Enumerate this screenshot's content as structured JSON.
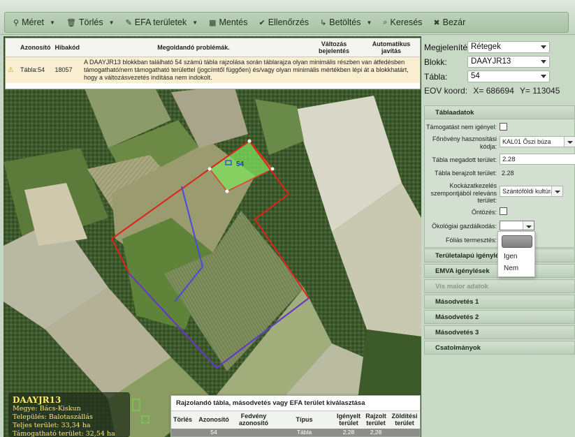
{
  "toolbar": {
    "items": [
      {
        "label": "Méret",
        "icon": "pin-icon",
        "glyph": "⚲",
        "dropdown": true
      },
      {
        "label": "Törlés",
        "icon": "trash-icon",
        "glyph": "🗑",
        "dropdown": true
      },
      {
        "label": "EFA területek",
        "icon": "pencil-icon",
        "glyph": "✎",
        "dropdown": true
      },
      {
        "label": "Mentés",
        "icon": "save-icon",
        "glyph": "▦",
        "dropdown": false
      },
      {
        "label": "Ellenőrzés",
        "icon": "check-icon",
        "glyph": "✔",
        "dropdown": false
      },
      {
        "label": "Betöltés",
        "icon": "load-icon",
        "glyph": "↳",
        "dropdown": true
      },
      {
        "label": "Keresés",
        "icon": "search-icon",
        "glyph": "⌕",
        "dropdown": false
      },
      {
        "label": "Bezár",
        "icon": "close-icon",
        "glyph": "✖",
        "dropdown": false
      }
    ]
  },
  "problems": {
    "headers": {
      "azonosito": "Azonosító",
      "hibakod": "Hibakód",
      "problem": "Megoldandó problémák.",
      "valtozas": "Változás bejelentés",
      "javitas": "Automatikus javítás"
    },
    "rows": [
      {
        "azonosito": "Tábla:54",
        "hibakod": "18057",
        "text": "A DAAYJR13 blokkban található 54 számú tábla rajzolása során táblarajza olyan minimális részben van átfedésben támogatható/nem támogatható területtel (jogcímtől függően) és/vagy olyan minimális mértékben lépi át a blokkhatárt, hogy a változásvezetés indítása nem indokolt."
      }
    ]
  },
  "map": {
    "parcel_label": "54"
  },
  "info_box": {
    "name": "DAAYJR13",
    "megye": "Megye: Bács-Kiskun",
    "telepules": "Település: Balotaszállás",
    "teljes": "Teljes terület: 33,34 ha",
    "tamogatott": "Támogatható terület: 32,54 ha"
  },
  "bottom_table": {
    "title": "Rajzolandó tábla, másodvetés vagy EFA terület kiválasztása",
    "headers": [
      "Törlés",
      "Azonosító",
      "Fedvény azonosító",
      "Típus",
      "Igényelt terület",
      "Rajzolt terület",
      "Zöldítési terület"
    ],
    "rows": [
      [
        "",
        "54",
        "",
        "Tábla",
        "2,28",
        "2,28",
        ""
      ]
    ]
  },
  "right_panel": {
    "megjelenites": {
      "label": "Megjelenítés:",
      "value": "Rétegek"
    },
    "blokk": {
      "label": "Blokk:",
      "value": "DAAYJR13"
    },
    "tabla": {
      "label": "Tábla:",
      "value": "54"
    },
    "eov": {
      "label": "EOV koord:",
      "x": "X= 686694",
      "y": "Y= 113045"
    },
    "tablaadatok": {
      "header": "Táblaadatok",
      "tamogatast_nem_igenyel": "Támogatást nem igényel:",
      "fonoveny_label": "Főnövény hasznosítási kódja:",
      "fonoveny_value": "KAL01 Őszi búza",
      "megadott_label": "Tábla megadott terület:",
      "megadott_value": "2.28",
      "berajzolt_label": "Tábla berajzolt terület:",
      "berajzolt_value": "2.28",
      "kockazat_label": "Kockázatkezelés szempontjából releváns terület:",
      "kockazat_value": "Szántóföldi kultúra",
      "ontozes": "Öntözés:",
      "okologiai": "Ökológiai gazdálkodás:",
      "folias": "Fóliás termesztés:"
    },
    "sections": [
      {
        "label": "Területalapú igénylés",
        "disabled": false
      },
      {
        "label": "EMVA igénylések",
        "disabled": false
      },
      {
        "label": "Vis maior adatok",
        "disabled": true
      },
      {
        "label": "Másodvetés 1",
        "disabled": false
      },
      {
        "label": "Másodvetés 2",
        "disabled": false
      },
      {
        "label": "Másodvetés 3",
        "disabled": false
      },
      {
        "label": "Csatolmányok",
        "disabled": false
      }
    ],
    "dropdown_options": [
      "",
      "Igen",
      "Nem"
    ]
  }
}
